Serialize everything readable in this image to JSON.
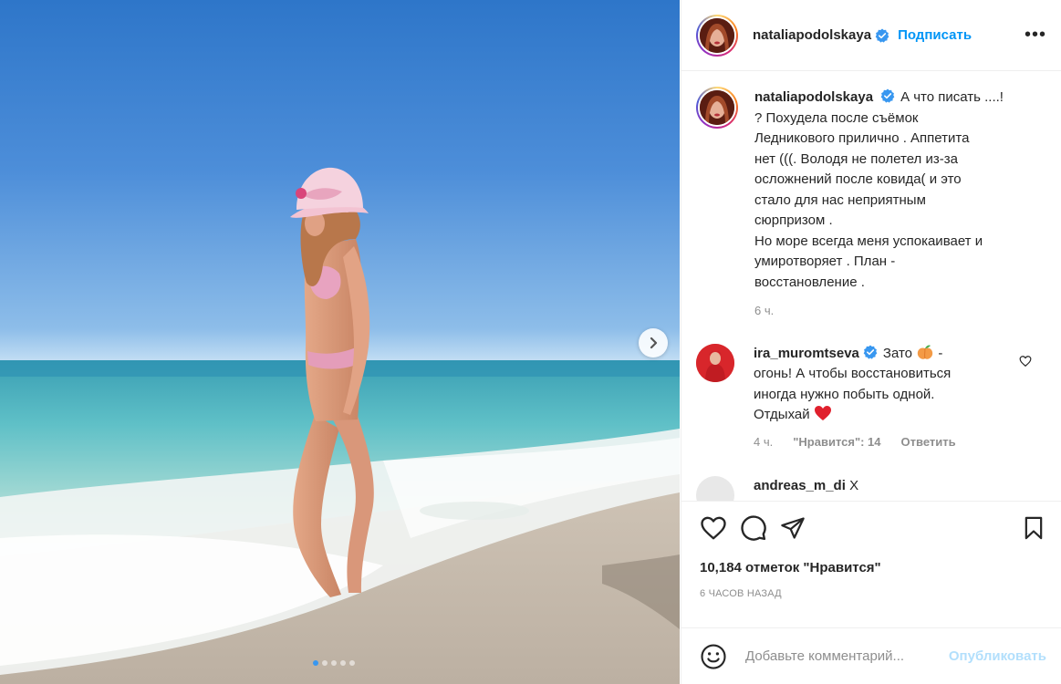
{
  "post": {
    "carousel": {
      "slides": 5,
      "active": 1
    }
  },
  "header": {
    "username": "nataliapodolskaya",
    "follow_label": "Подписать",
    "more_label": "•••"
  },
  "caption": {
    "username": "nataliapodolskaya",
    "lines": [
      "А что писать ....!",
      "? Похудела после съёмок",
      "Ледникового прилично . Аппетита",
      "нет (((. Володя не полетел из-за",
      "осложнений после ковида( и это",
      "стало для нас неприятным",
      "сюрпризом .",
      "Но море всегда меня успокаивает и",
      "умиротворяет . План -",
      "восстановление ."
    ],
    "time": "6 ч."
  },
  "comment": {
    "username": "ira_muromtseva",
    "text_start": "Зато",
    "text_rest": "-",
    "lines": [
      "огонь! А чтобы восстановиться",
      "иногда нужно побыть одной.",
      "Отдыхай"
    ],
    "time": "4 ч.",
    "likes": "\"Нравится\": 14",
    "reply": "Ответить"
  },
  "next_comment_partial": {
    "username": "andreas_m_di",
    "text": "Х"
  },
  "stats": {
    "likes": "10,184 отметок \"Нравится\"",
    "ago": "6 ЧАСОВ НАЗАД"
  },
  "add_comment": {
    "placeholder": "Добавьте комментарий...",
    "publish_label": "Опубликовать"
  },
  "colors": {
    "accent": "#0095f6",
    "verified": "#3897f0",
    "muted": "#8e8e8e"
  }
}
